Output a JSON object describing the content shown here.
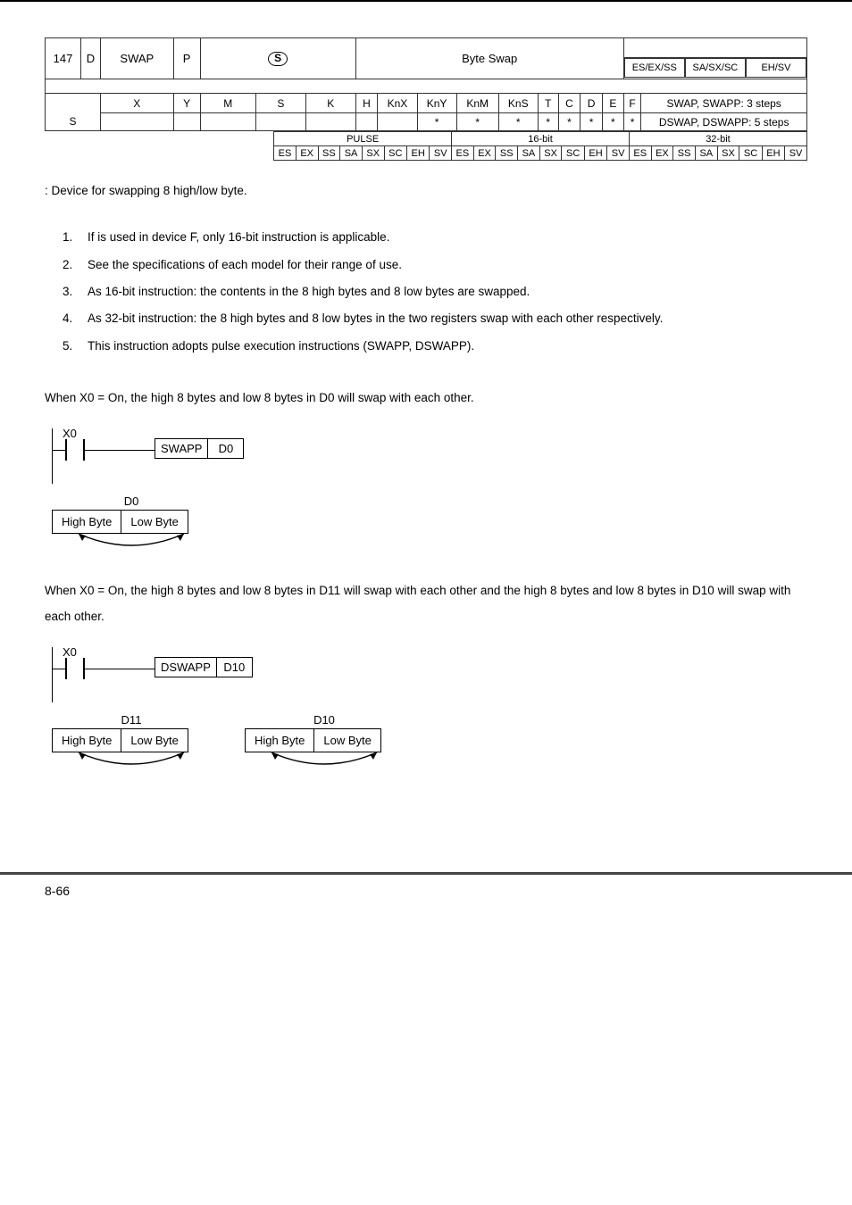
{
  "header_table": {
    "opnum": "147",
    "dcell": "D",
    "name": "SWAP",
    "pcell": "P",
    "desc": "Byte Swap",
    "models": [
      "ES/EX/SS",
      "SA/SX/SC",
      "EH/SV"
    ]
  },
  "cols": [
    "X",
    "Y",
    "M",
    "S",
    "K",
    "H",
    "KnX",
    "KnY",
    "KnM",
    "KnS",
    "T",
    "C",
    "D",
    "E",
    "F"
  ],
  "srow_label": "S",
  "srow_marks": [
    "",
    "",
    "",
    "",
    "",
    "",
    "",
    "*",
    "*",
    "*",
    "*",
    "*",
    "*",
    "*",
    "*"
  ],
  "steps": {
    "swap": "SWAP, SWAPP: 3 steps",
    "dswap": "DSWAP, DSWAPP: 5 steps"
  },
  "pulse": {
    "h1": "PULSE",
    "h2": "16-bit",
    "h3": "32-bit",
    "cells": [
      "ES",
      "EX",
      "SS",
      "SA",
      "SX",
      "SC",
      "EH",
      "SV",
      "ES",
      "EX",
      "SS",
      "SA",
      "SX",
      "SC",
      "EH",
      "SV",
      "ES",
      "EX",
      "SS",
      "SA",
      "SX",
      "SC",
      "EH",
      "SV"
    ]
  },
  "note": ": Device for swapping 8 high/low byte.",
  "list": [
    "If   is used in device F, only 16-bit instruction is applicable.",
    "See the specifications of each model for their range of use.",
    "As 16-bit instruction: the contents in the 8 high bytes and 8 low bytes are swapped.",
    "As 32-bit instruction: the 8 high bytes and 8 low bytes in the two registers swap with each other respectively.",
    "This instruction adopts pulse execution instructions (SWAPP, DSWAPP)."
  ],
  "ex1": {
    "intro": "When X0 = On, the high 8 bytes and low 8 bytes in D0 will swap with each other.",
    "xlabel": "X0",
    "inst": "SWAPP",
    "operand": "D0",
    "reg": "D0",
    "hb": "High Byte",
    "lb": "Low Byte"
  },
  "ex2": {
    "intro": "When X0 = On, the high 8 bytes and low 8 bytes in D11 will swap with each other and the high 8 bytes and low 8 bytes in D10 will swap with each other.",
    "xlabel": "X0",
    "inst": "DSWAPP",
    "operand": "D10",
    "reg1": "D11",
    "reg2": "D10",
    "hb": "High Byte",
    "lb": "Low Byte"
  },
  "footer": "8-66"
}
